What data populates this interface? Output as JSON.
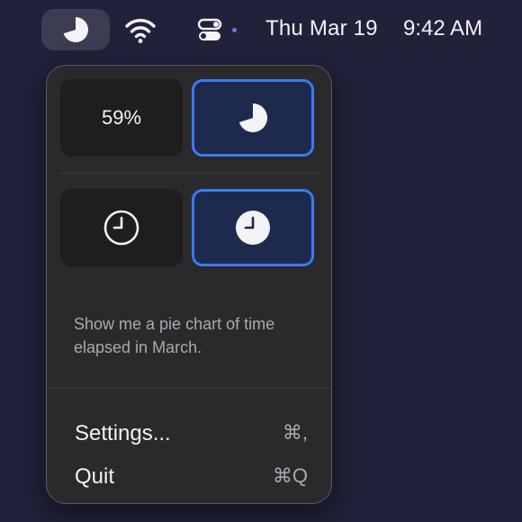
{
  "menubar": {
    "app_icon": "pie-chart-icon",
    "wifi_icon": "wifi-icon",
    "control_center_icon": "control-center-icon",
    "date": "Thu Mar 19",
    "time": "9:42 AM"
  },
  "panel": {
    "display_options": [
      {
        "id": "percent",
        "label": "59%",
        "selected": false
      },
      {
        "id": "pie",
        "icon": "pie-chart-icon",
        "selected": true
      }
    ],
    "icon_styles": [
      {
        "id": "clock-outline",
        "icon": "clock-outline-icon",
        "selected": false
      },
      {
        "id": "clock-filled",
        "icon": "clock-filled-icon",
        "selected": true
      }
    ],
    "prompt_text": "Show me a pie chart of time elapsed in March.",
    "menu": [
      {
        "label": "Settings...",
        "shortcut": "⌘,"
      },
      {
        "label": "Quit",
        "shortcut": "⌘Q"
      }
    ]
  },
  "colors": {
    "background": "#21213a",
    "panel": "#2a2a2c",
    "accent": "#3a7bf2",
    "selected_fill": "#1d2a4d"
  }
}
